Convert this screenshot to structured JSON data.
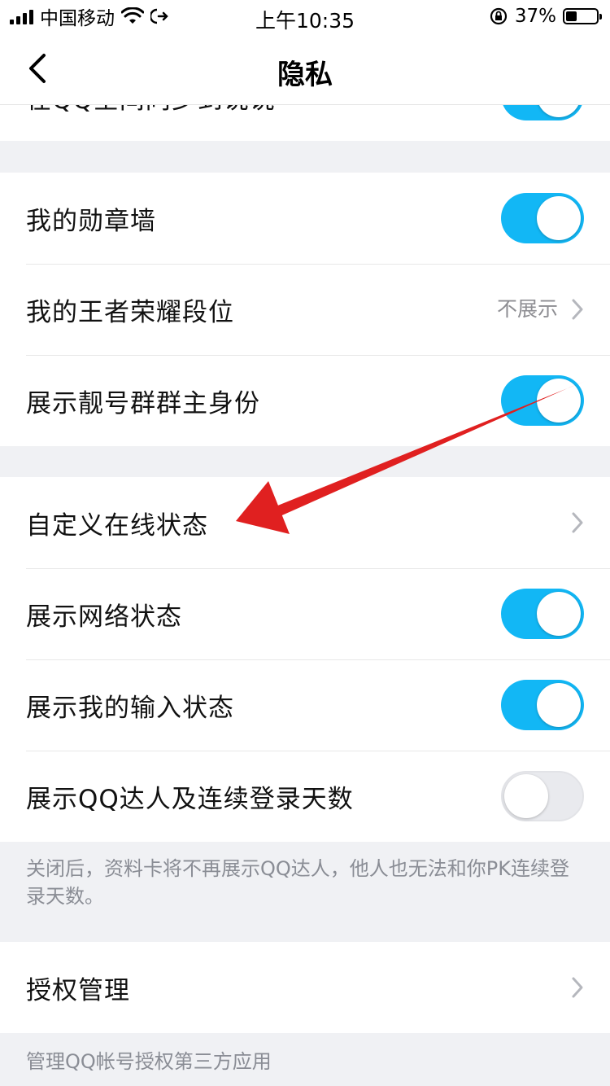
{
  "status_bar": {
    "carrier": "中国移动",
    "time": "上午10:35",
    "battery": "37%",
    "battery_level": 0.37
  },
  "nav": {
    "title": "隐私"
  },
  "partial_row": {
    "label": "在QQ空间同步到说说",
    "toggle_on": true
  },
  "group_badges": [
    {
      "label": "我的勋章墙",
      "control": "toggle",
      "on": true
    },
    {
      "label": "我的王者荣耀段位",
      "control": "value",
      "value": "不展示"
    },
    {
      "label": "展示靓号群群主身份",
      "control": "toggle",
      "on": true
    }
  ],
  "group_status": [
    {
      "label": "自定义在线状态",
      "control": "chevron"
    },
    {
      "label": "展示网络状态",
      "control": "toggle",
      "on": true
    },
    {
      "label": "展示我的输入状态",
      "control": "toggle",
      "on": true
    },
    {
      "label": "展示QQ达人及连续登录天数",
      "control": "toggle",
      "on": false
    }
  ],
  "footnote_status": "关闭后，资料卡将不再展示QQ达人，他人也无法和你PK连续登录天数。",
  "group_auth": [
    {
      "label": "授权管理",
      "control": "chevron"
    }
  ],
  "footnote_auth": "管理QQ帐号授权第三方应用",
  "colors": {
    "accent": "#12b7f5",
    "annotation_arrow": "#e02020",
    "background": "#f0f1f4"
  }
}
